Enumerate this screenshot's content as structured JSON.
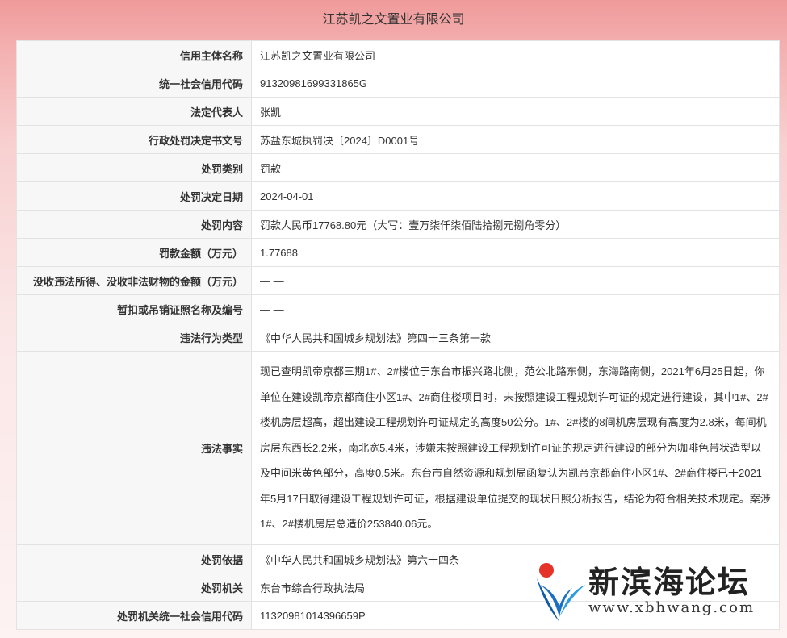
{
  "title": "江苏凯之文置业有限公司",
  "rows": [
    {
      "label": "信用主体名称",
      "value": "江苏凯之文置业有限公司"
    },
    {
      "label": "统一社会信用代码",
      "value": "91320981699331865G"
    },
    {
      "label": "法定代表人",
      "value": "张凯"
    },
    {
      "label": "行政处罚决定书文号",
      "value": "苏盐东城执罚决〔2024〕D0001号"
    },
    {
      "label": "处罚类别",
      "value": "罚款"
    },
    {
      "label": "处罚决定日期",
      "value": "2024-04-01"
    },
    {
      "label": "处罚内容",
      "value": "罚款人民币17768.80元（大写：壹万柒仟柒佰陆拾捌元捌角零分）"
    },
    {
      "label": "罚款金额（万元）",
      "value": "1.77688"
    },
    {
      "label": "没收违法所得、没收非法财物的金额（万元）",
      "value": "— —"
    },
    {
      "label": "暂扣或吊销证照名称及编号",
      "value": "— —"
    },
    {
      "label": "违法行为类型",
      "value": "《中华人民共和国城乡规划法》第四十三条第一款"
    },
    {
      "label": "违法事实",
      "value": "现已查明凯帝京都三期1#、2#楼位于东台市振兴路北侧，范公北路东侧，东海路南侧，2021年6月25日起，你单位在建设凯帝京都商住小区1#、2#商住楼项目时，未按照建设工程规划许可证的规定进行建设，其中1#、2#楼机房层超高，超出建设工程规划许可证规定的高度50公分。1#、2#楼的8间机房层现有高度为2.8米，每间机房层东西长2.2米，南北宽5.4米，涉嫌未按照建设工程规划许可证的规定进行建设的部分为咖啡色带状造型以及中间米黄色部分，高度0.5米。东台市自然资源和规划局函复认为凯帝京都商住小区1#、2#商住楼已于2021年5月17日取得建设工程规划许可证，根据建设单位提交的现状日照分析报告，结论为符合相关技术规定。案涉1#、2#楼机房层总造价253840.06元。"
    },
    {
      "label": "处罚依据",
      "value": "《中华人民共和国城乡规划法》第六十四条"
    },
    {
      "label": "处罚机关",
      "value": "东台市综合行政执法局"
    },
    {
      "label": "处罚机关统一社会信用代码",
      "value": "11320981014396659P"
    }
  ],
  "watermark": {
    "name": "新滨海论坛",
    "url": "www.xbhwang.com",
    "logo_icon": "xb-logo-icon"
  }
}
